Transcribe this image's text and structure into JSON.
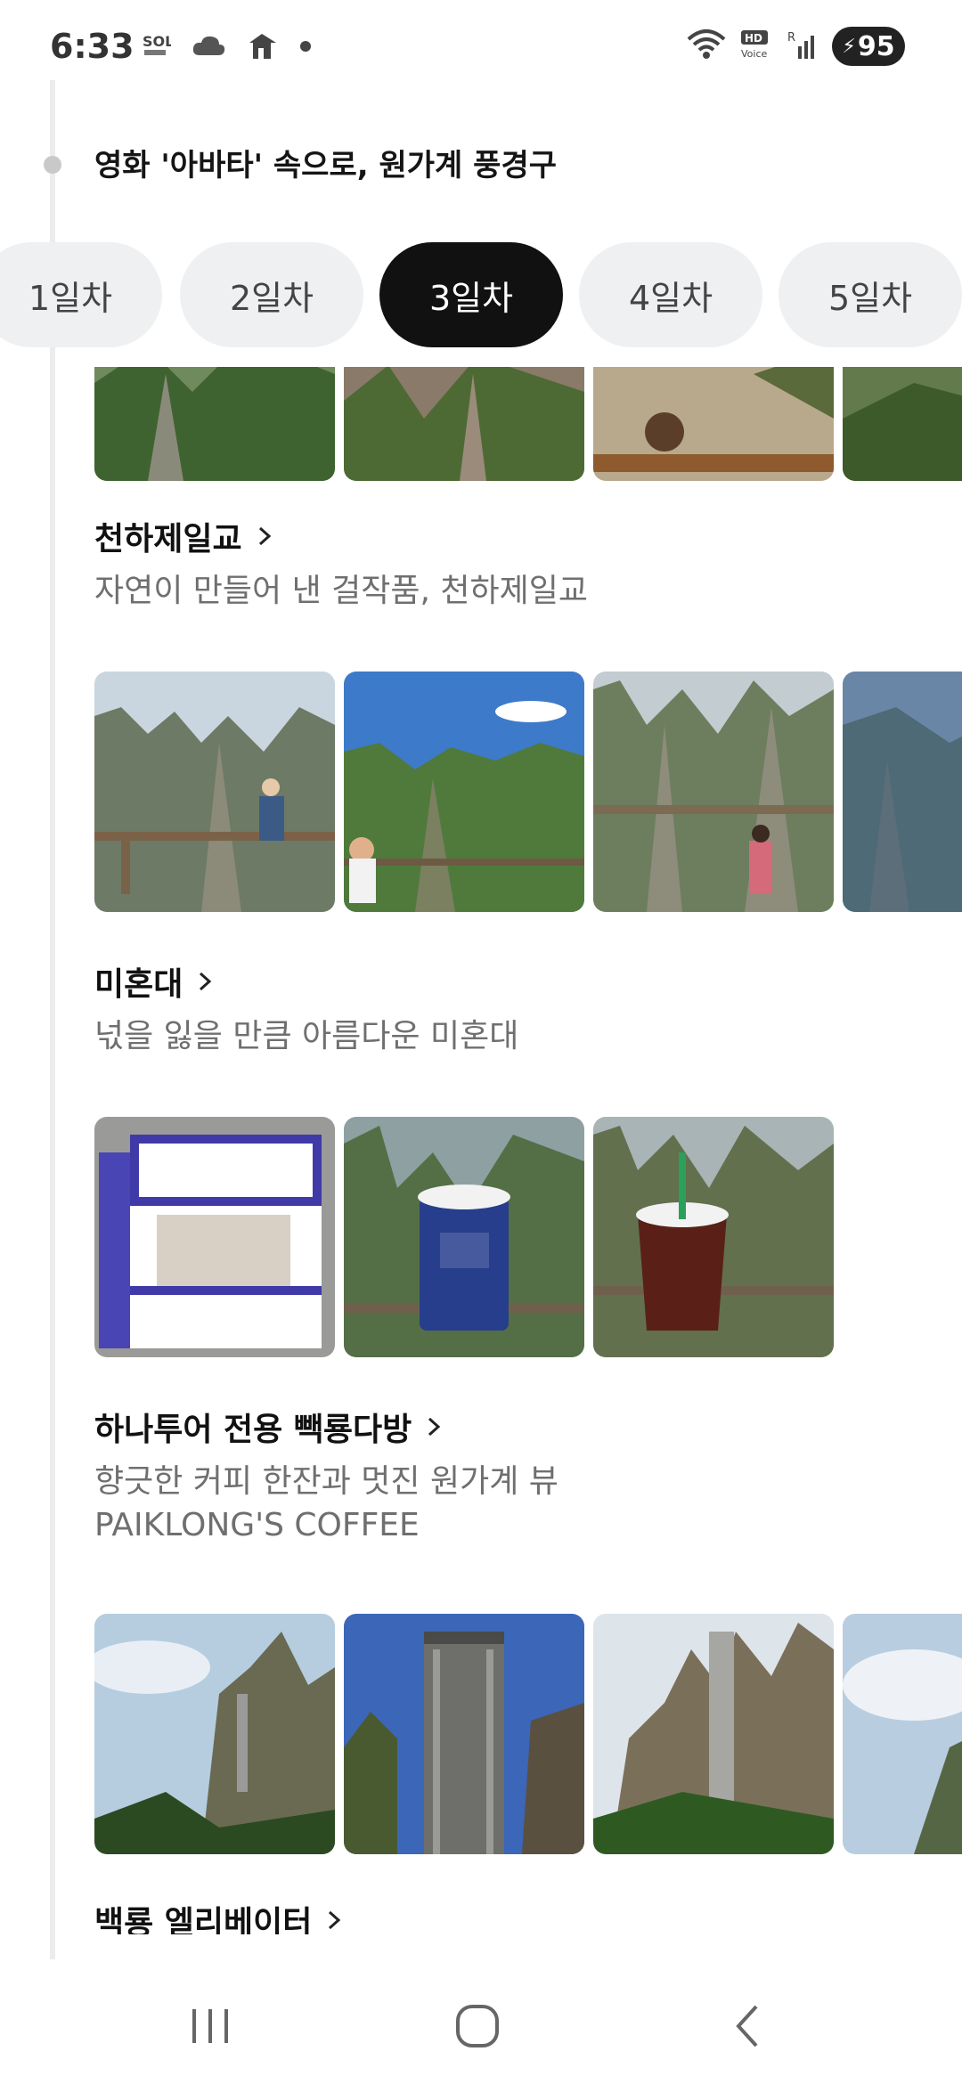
{
  "status": {
    "time": "6:33",
    "left_icons": [
      "sol-icon",
      "cloud-icon",
      "app-notification-icon",
      "dot-icon"
    ],
    "right_icons": [
      "wifi-icon",
      "hd-voice-icon",
      "signal-icon"
    ],
    "hd_voice_text": "HD Voice",
    "battery": "95"
  },
  "route_title": "영화 '아바타' 속으로, 원가계 풍경구",
  "day_tabs": [
    {
      "label": "1일차",
      "active": false
    },
    {
      "label": "2일차",
      "active": false
    },
    {
      "label": "3일차",
      "active": true
    },
    {
      "label": "4일차",
      "active": false
    },
    {
      "label": "5일차",
      "active": false
    }
  ],
  "places": [
    {
      "name": "천하제일교",
      "desc": [
        "자연이 만들어 낸 걸작품, 천하제일교"
      ]
    },
    {
      "name": "미혼대",
      "desc": [
        "넋을 잃을 만큼 아름다운 미혼대"
      ]
    },
    {
      "name": "하나투어 전용 빽룡다방",
      "desc": [
        "향긋한 커피 한잔과 멋진 원가계 뷰",
        "PAIKLONG'S COFFEE"
      ]
    },
    {
      "name": "백룡 엘리베이터",
      "desc": []
    }
  ],
  "nav": {
    "icons": [
      "recent-apps-icon",
      "home-icon",
      "back-icon"
    ]
  },
  "colors": {
    "active_tab_bg": "#111111",
    "tab_bg": "#eef0f2",
    "desc_text": "#6f6f6f",
    "timeline": "#ececec"
  }
}
